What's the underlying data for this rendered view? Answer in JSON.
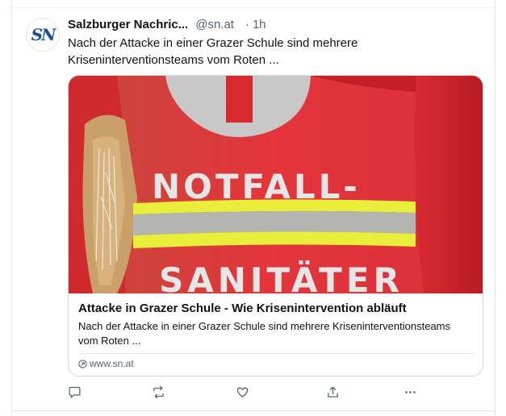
{
  "post": {
    "author": {
      "name": "Salzburger Nachric...",
      "handle": "@sn.at",
      "separator": "·",
      "time": "1h",
      "avatar_text": "SN"
    },
    "text": "Nach der Attacke in einer Grazer Schule sind mehrere Kriseninterventionsteams vom Roten ...",
    "card": {
      "image_text_top": "NOTFALL-",
      "image_text_bottom": "SANITÄTER",
      "title": "Attacke in Grazer Schule - Wie Krisenintervention abläuft",
      "description": "Nach der Attacke in einer Grazer Schule sind mehrere Kriseninterventionsteams vom Roten ...",
      "domain": "www.sn.at"
    },
    "actions": [
      {
        "name": "reply",
        "icon": "reply-icon"
      },
      {
        "name": "repost",
        "icon": "repost-icon"
      },
      {
        "name": "like",
        "icon": "heart-icon"
      },
      {
        "name": "share",
        "icon": "share-icon"
      },
      {
        "name": "more",
        "icon": "more-icon"
      }
    ]
  },
  "colors": {
    "brand_blue": "#1c4e96",
    "vest_red": "#e0262f",
    "reflective_yellow": "#e8ee3a",
    "secondary_text": "#536471",
    "border": "#cfd9de"
  }
}
